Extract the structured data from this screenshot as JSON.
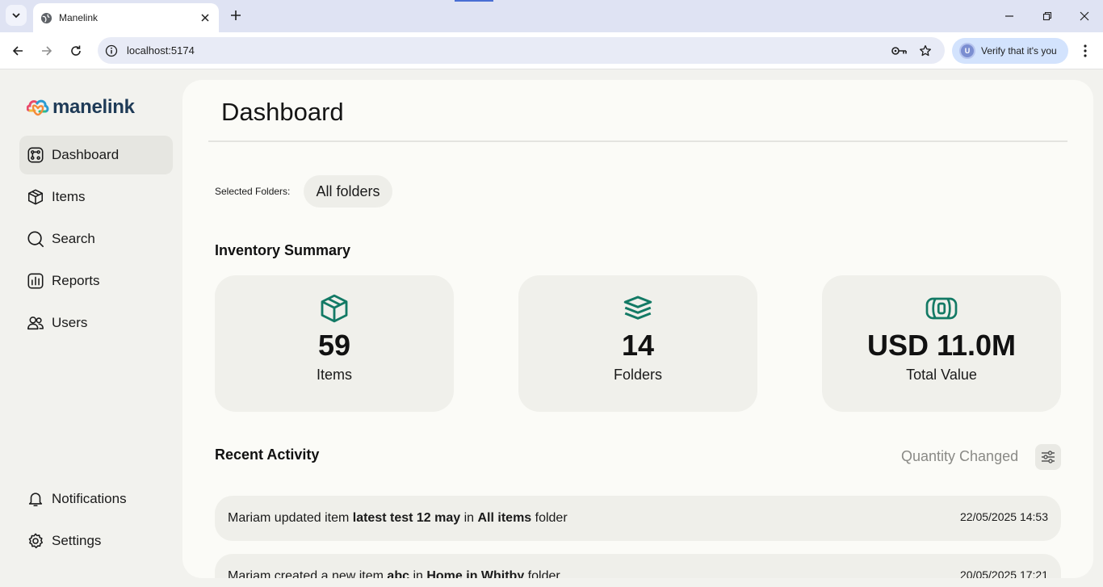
{
  "browser": {
    "tab_title": "Manelink",
    "url": "localhost:5174",
    "verify_label": "Verify that it's you",
    "avatar_initial": "U"
  },
  "app": {
    "logo_text": "manelink",
    "sidebar": {
      "items": [
        {
          "label": "Dashboard",
          "icon": "dashboard-icon",
          "active": true
        },
        {
          "label": "Items",
          "icon": "box-icon"
        },
        {
          "label": "Search",
          "icon": "search-icon"
        },
        {
          "label": "Reports",
          "icon": "reports-icon"
        },
        {
          "label": "Users",
          "icon": "users-icon"
        }
      ],
      "bottom_items": [
        {
          "label": "Notifications",
          "icon": "bell-icon"
        },
        {
          "label": "Settings",
          "icon": "gear-icon"
        }
      ]
    }
  },
  "main": {
    "title": "Dashboard",
    "folders_label": "Selected Folders:",
    "folder_chip": "All folders",
    "summary": {
      "title": "Inventory Summary",
      "cards": [
        {
          "value": "59",
          "label": "Items",
          "icon": "box-icon"
        },
        {
          "value": "14",
          "label": "Folders",
          "icon": "layers-icon"
        },
        {
          "value": "USD 11.0M",
          "label": "Total Value",
          "icon": "money-icon"
        }
      ]
    },
    "activity": {
      "title": "Recent Activity",
      "filter_label": "Quantity Changed",
      "rows": [
        {
          "user": "Mariam",
          "action": " updated item ",
          "item": "latest test 12 may",
          "prep": " in ",
          "folder": "All items",
          "suffix": " folder",
          "time": "22/05/2025 14:53"
        },
        {
          "user": "Mariam",
          "action": " created a new item ",
          "item": "abc",
          "prep": " in ",
          "folder": "Home in Whitby",
          "suffix": " folder",
          "time": "20/05/2025 17:21"
        }
      ]
    }
  },
  "colors": {
    "accent": "#137a65",
    "sidebar_bg": "#f2f2ee",
    "main_bg": "#fbfbf7",
    "card_bg": "#f0f0eb"
  }
}
